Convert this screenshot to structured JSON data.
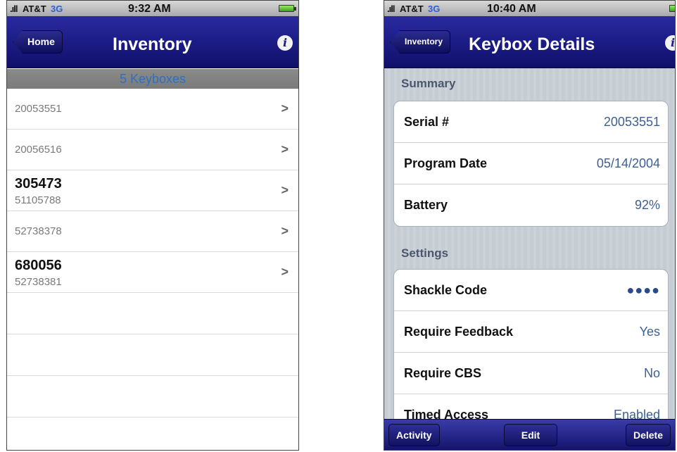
{
  "left": {
    "status": {
      "carrier": "AT&T",
      "network": "3G",
      "time": "9:32 AM"
    },
    "nav": {
      "back_label": "Home",
      "title": "Inventory"
    },
    "section_header": "5 Keyboxes",
    "items": [
      {
        "serial": "20053551"
      },
      {
        "serial": "20056516"
      },
      {
        "title": "305473",
        "subtitle": "51105788"
      },
      {
        "serial": "52738378"
      },
      {
        "title": "680056",
        "subtitle": "52738381"
      }
    ]
  },
  "right": {
    "status": {
      "carrier": "AT&T",
      "network": "3G",
      "time": "10:40 AM"
    },
    "nav": {
      "back_label": "Inventory",
      "title": "Keybox Details"
    },
    "summary": {
      "label": "Summary",
      "rows": [
        {
          "label": "Serial #",
          "value": "20053551"
        },
        {
          "label": "Program Date",
          "value": "05/14/2004"
        },
        {
          "label": "Battery",
          "value": "92%"
        }
      ]
    },
    "settings": {
      "label": "Settings",
      "rows": [
        {
          "label": "Shackle Code",
          "value": "●●●●"
        },
        {
          "label": "Require Feedback",
          "value": "Yes"
        },
        {
          "label": "Require CBS",
          "value": "No"
        },
        {
          "label": "Timed Access",
          "value": "Enabled"
        }
      ]
    },
    "toolbar": {
      "activity": "Activity",
      "edit": "Edit",
      "delete": "Delete"
    }
  }
}
